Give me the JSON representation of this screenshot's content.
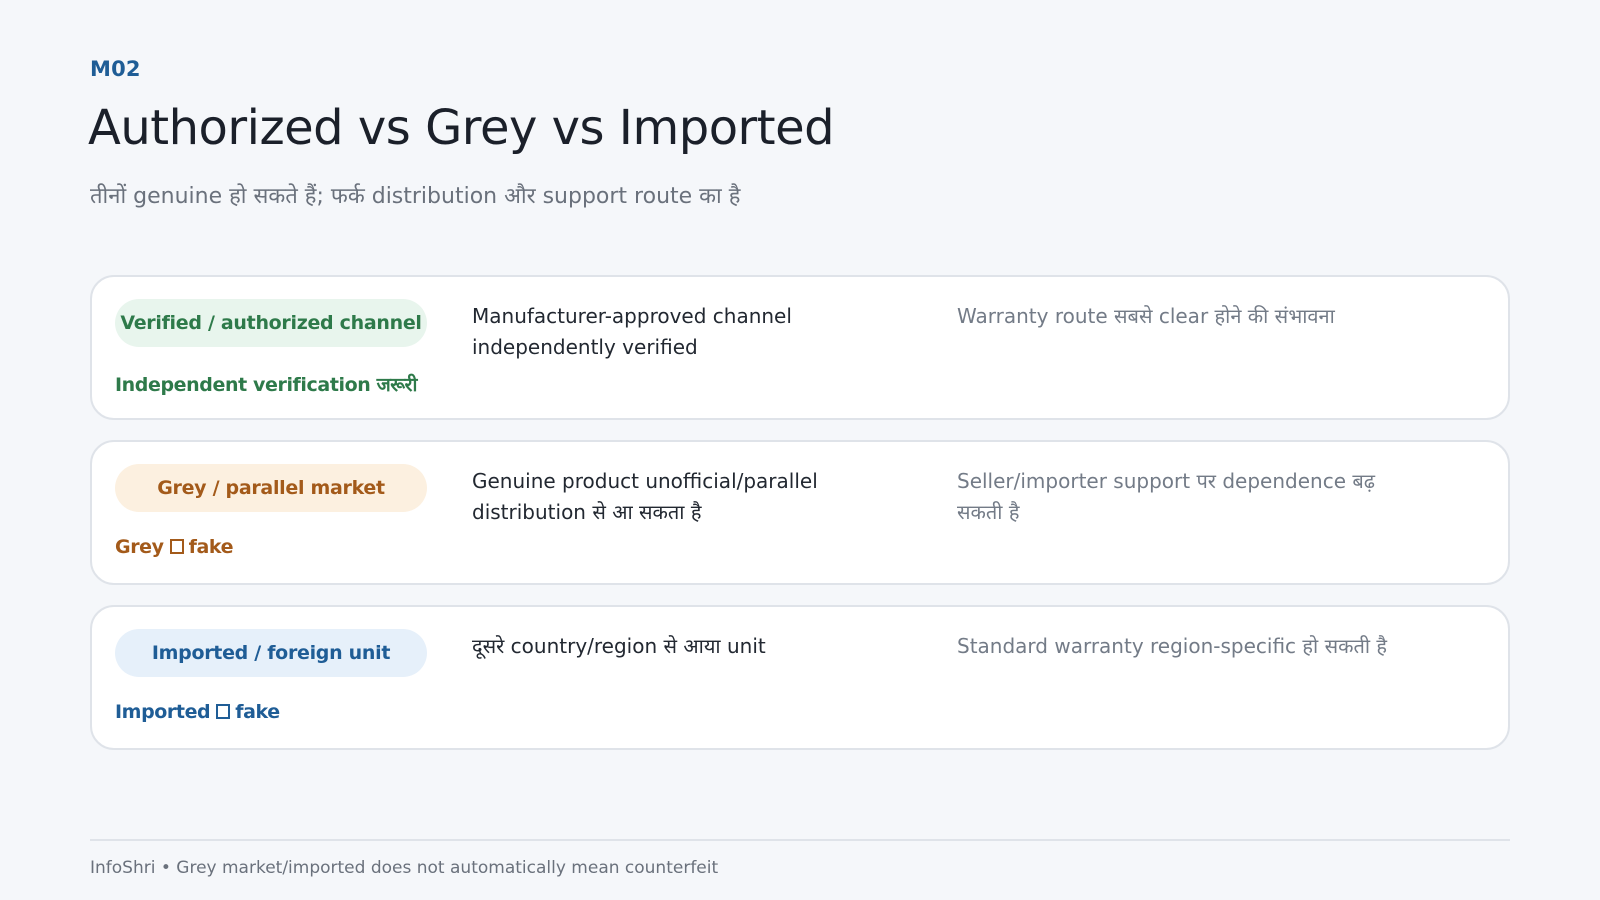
{
  "header": {
    "module_code": "M02",
    "title": "Authorized vs Grey vs Imported",
    "subtitle": "तीनों genuine हो सकते हैं; फर्क distribution और support route का है"
  },
  "rows": [
    {
      "label": "Verified / authorized channel",
      "note_text": "Independent verification जरूरी",
      "description": "Manufacturer-approved channel independently verified",
      "warranty": "Warranty route सबसे clear होने की संभावना",
      "accent": "#2e7a4a",
      "pill_bg": "#e8f5ed"
    },
    {
      "label": "Grey / parallel market",
      "note_prefix": "Grey",
      "note_suffix": "fake",
      "description": "Genuine product unofficial/parallel distribution से आ सकता है",
      "warranty": "Seller/importer support पर dependence बढ़ सकती है",
      "accent": "#a35a1a",
      "pill_bg": "#fcf0e0"
    },
    {
      "label": "Imported / foreign unit",
      "note_prefix": "Imported",
      "note_suffix": "fake",
      "description": "दूसरे country/region से आया unit",
      "warranty": "Standard warranty region-specific हो सकती है",
      "accent": "#1f5d96",
      "pill_bg": "#e6f0fa"
    }
  ],
  "footer": {
    "text": "InfoShri • Grey market/imported does not automatically mean counterfeit"
  }
}
